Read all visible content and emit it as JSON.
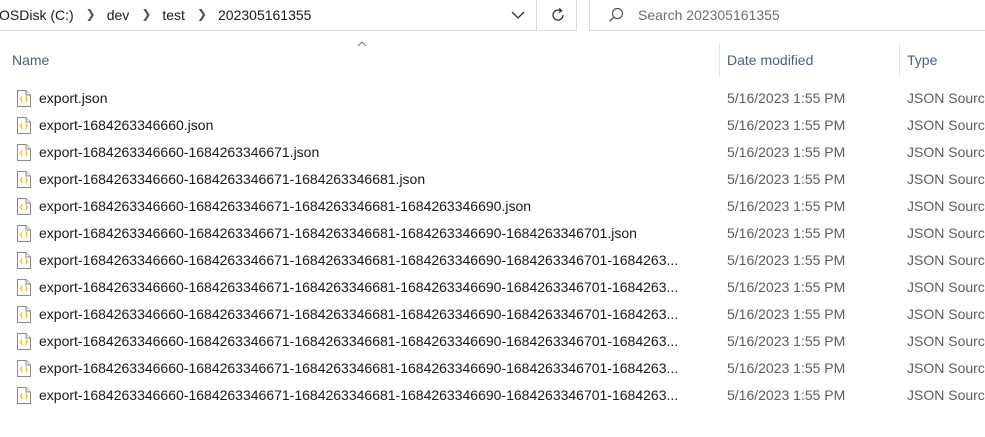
{
  "breadcrumb": {
    "items": [
      "OSDisk (C:)",
      "dev",
      "test",
      "202305161355"
    ]
  },
  "search": {
    "placeholder": "Search 202305161355"
  },
  "columns": {
    "name": "Name",
    "date_modified": "Date modified",
    "type": "Type"
  },
  "files": [
    {
      "name": "export.json",
      "date": "5/16/2023 1:55 PM",
      "type": "JSON Source File"
    },
    {
      "name": "export-1684263346660.json",
      "date": "5/16/2023 1:55 PM",
      "type": "JSON Source File"
    },
    {
      "name": "export-1684263346660-1684263346671.json",
      "date": "5/16/2023 1:55 PM",
      "type": "JSON Source File"
    },
    {
      "name": "export-1684263346660-1684263346671-1684263346681.json",
      "date": "5/16/2023 1:55 PM",
      "type": "JSON Source File"
    },
    {
      "name": "export-1684263346660-1684263346671-1684263346681-1684263346690.json",
      "date": "5/16/2023 1:55 PM",
      "type": "JSON Source File"
    },
    {
      "name": "export-1684263346660-1684263346671-1684263346681-1684263346690-1684263346701.json",
      "date": "5/16/2023 1:55 PM",
      "type": "JSON Source File"
    },
    {
      "name": "export-1684263346660-1684263346671-1684263346681-1684263346690-1684263346701-1684263...",
      "date": "5/16/2023 1:55 PM",
      "type": "JSON Source File"
    },
    {
      "name": "export-1684263346660-1684263346671-1684263346681-1684263346690-1684263346701-1684263...",
      "date": "5/16/2023 1:55 PM",
      "type": "JSON Source File"
    },
    {
      "name": "export-1684263346660-1684263346671-1684263346681-1684263346690-1684263346701-1684263...",
      "date": "5/16/2023 1:55 PM",
      "type": "JSON Source File"
    },
    {
      "name": "export-1684263346660-1684263346671-1684263346681-1684263346690-1684263346701-1684263...",
      "date": "5/16/2023 1:55 PM",
      "type": "JSON Source File"
    },
    {
      "name": "export-1684263346660-1684263346671-1684263346681-1684263346690-1684263346701-1684263...",
      "date": "5/16/2023 1:55 PM",
      "type": "JSON Source File"
    },
    {
      "name": "export-1684263346660-1684263346671-1684263346681-1684263346690-1684263346701-1684263...",
      "date": "5/16/2023 1:55 PM",
      "type": "JSON Source File"
    }
  ],
  "icons": {
    "file": "json-file-icon",
    "search": "search-icon",
    "refresh": "refresh-icon",
    "dropdown": "chevron-down-icon",
    "separator": "chevron-right-icon",
    "sort": "sort-up-icon"
  },
  "colors": {
    "header_text": "#4c607a",
    "file_icon_accent": "#e8b500",
    "border": "#d9d9d9"
  }
}
